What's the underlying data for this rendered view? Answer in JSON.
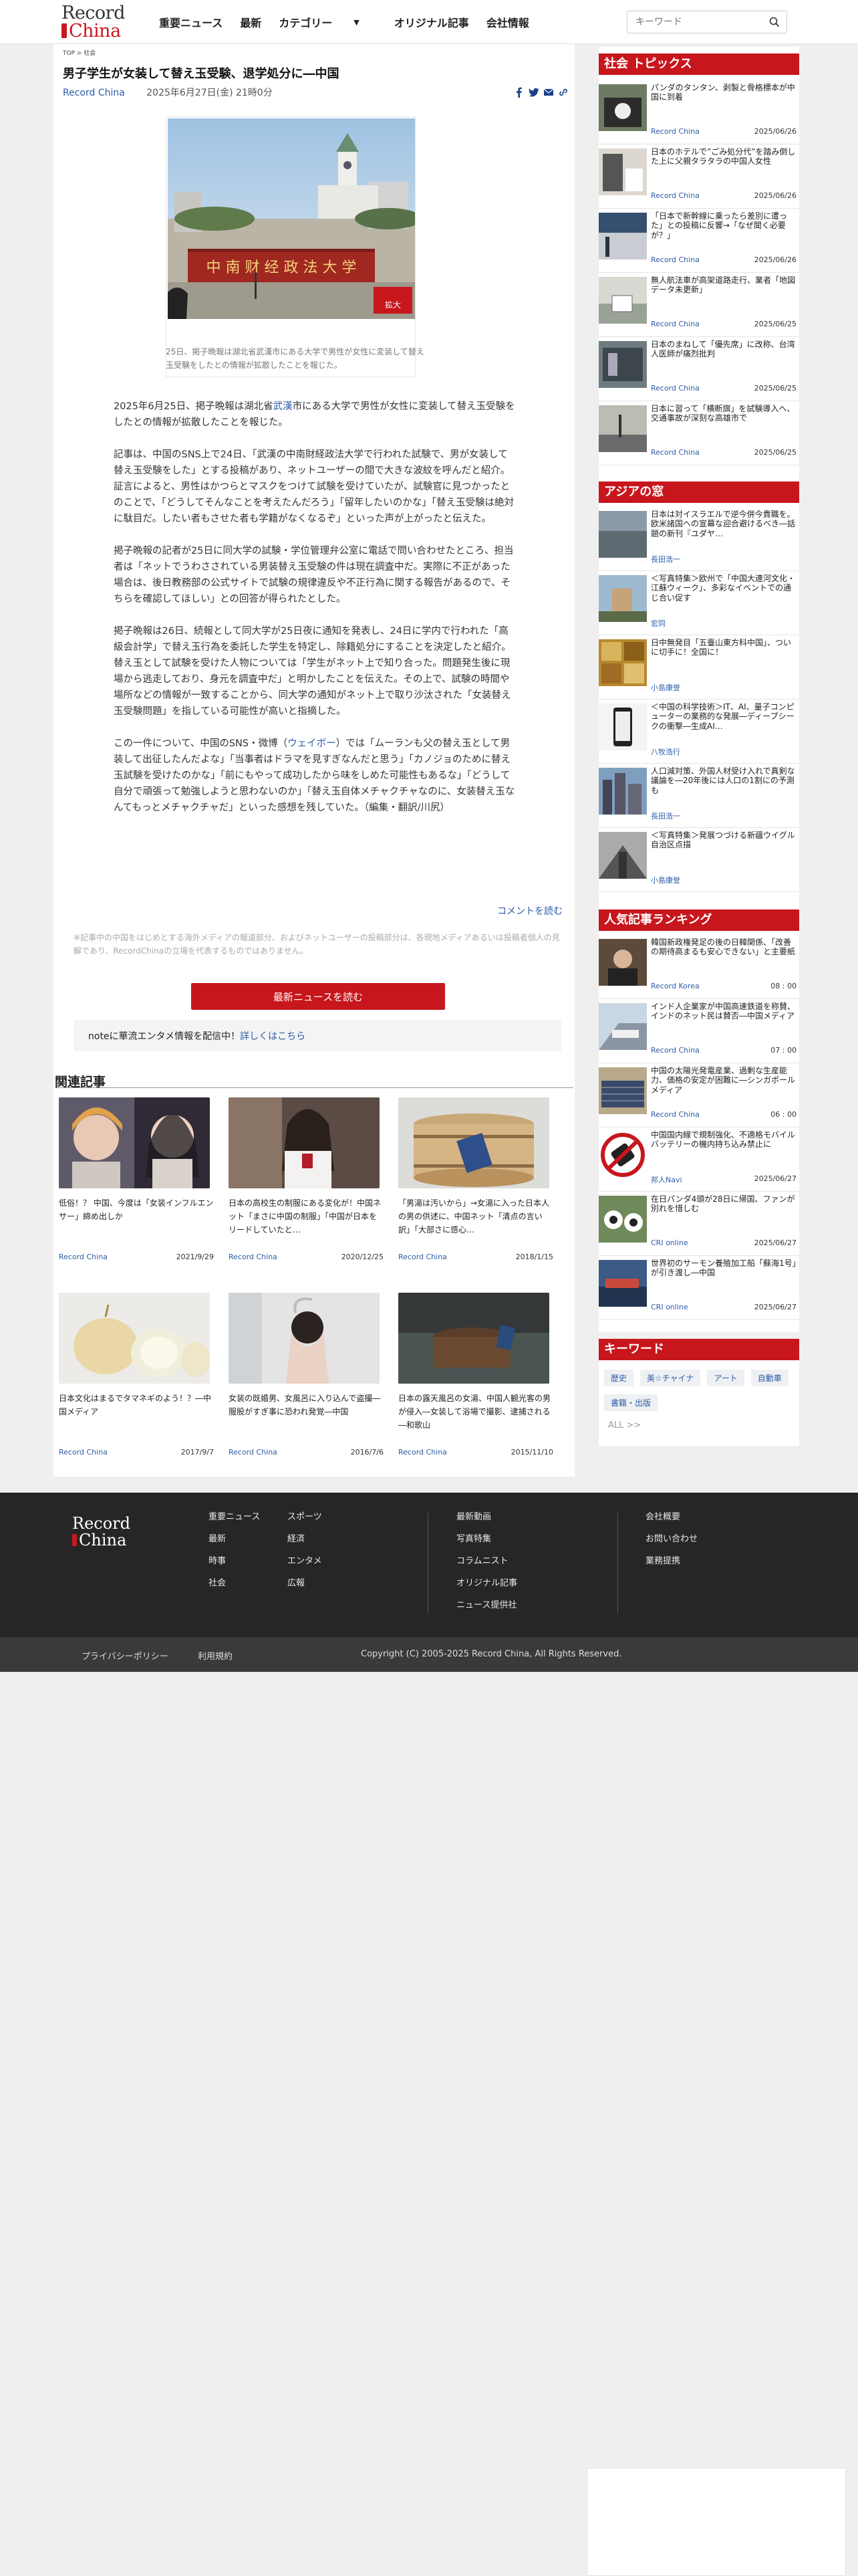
{
  "header": {
    "logo_line1": "Record",
    "logo_line2": "China",
    "nav": [
      "重要ニュース",
      "最新",
      "カテゴリー",
      "オリジナル記事",
      "会社情報"
    ],
    "category_chevron": "▼",
    "search_placeholder": "キーワード"
  },
  "article": {
    "breadcrumb": "TOP > 社会",
    "title": "男子学生が女装して替え玉受験、退学処分に―中国",
    "source": "Record China",
    "date": "2025年6月27日(金) 21時0分",
    "photo_sign": "中 南 财 经 政 法 大 学",
    "zoom": "拡大",
    "caption": "25日、掲子晩報は湖北省武漢市にある大学で男性が女性に変装して替え玉受験をしたとの情報が拡散したことを報じた。",
    "paragraphs": [
      {
        "pre": "2025年6月25日、掲子晩報は湖北省",
        "link": "武漢",
        "post": "市にある大学で男性が女性に変装して替え玉受験をしたとの情報が拡散したことを報じた。"
      },
      {
        "pre": "記事は、中国のSNS上で24日、「武漢の中南財経政法大学で行われた試験で、男が女装して替え玉受験をした」とする投稿があり、ネットユーザーの間で大きな波紋を呼んだと紹介。証言によると、男性はかつらとマスクをつけて試験を受けていたが、試験官に見つかったとのことで、「どうしてそんなことを考えたんだろう」「留年したいのかな」「替え玉受験は絶対に駄目だ。したい者もさせた者も学籍がなくなるぞ」といった声が上がったと伝えた。",
        "link": "",
        "post": ""
      },
      {
        "pre": "掲子晩報の記者が25日に同大学の試験・学位管理弁公室に電話で問い合わせたところ、担当者は「ネットでうわさされている男装替え玉受験の件は現在調査中だ。実際に不正があった場合は、後日教務部の公式サイトで試験の規律違反や不正行為に関する報告があるので、そちらを確認してほしい」との回答が得られたとした。",
        "link": "",
        "post": ""
      },
      {
        "pre": "掲子晩報は26日、続報として同大学が25日夜に通知を発表し、24日に学内で行われた「高級会計学」で替え玉行為を委託した学生を特定し、除籍処分にすることを決定したと紹介。替え玉として試験を受けた人物については「学生がネット上で知り合った。問題発生後に現場から逃走しており、身元を調査中だ」と明かしたことを伝えた。その上で、試験の時間や場所などの情報が一致することから、同大学の通知がネット上で取り沙汰された「女装替え玉受験問題」を指している可能性が高いと指摘した。",
        "link": "",
        "post": ""
      },
      {
        "pre": "この一件について、中国のSNS・微博（",
        "link": "ウェイボー",
        "post": "）では「ムーランも父の替え玉として男装して出征したんだよな」「当事者はドラマを見すぎなんだと思う」「カノジョのために替え玉試験を受けたのかな」「前にもやって成功したから味をしめた可能性もあるな」「どうして自分で頑張って勉強しようと思わないのか」「替え玉自体メチャクチャなのに、女装替え玉なんてもっとメチャクチャだ」といった感想を残していた。（編集・翻訳/川尻）"
      }
    ],
    "comments_link": "コメントを読む",
    "disclaimer": "※記事中の中国をはじめとする海外メディアの報道部分、およびネットユーザーの投稿部分は、各現地メディアあるいは投稿者個人の見解であり、RecordChinaの立場を代表するものではありません。",
    "read_news_button": "最新ニュースを読む",
    "note_text": "noteに華流エンタメ情報を配信中！",
    "note_link": "詳しくはこちら"
  },
  "related": {
    "heading": "関連記事",
    "items": [
      {
        "title": "低俗！？ 中国、今度は「女装インフルエンサー」締め出しか",
        "source": "Record China",
        "date": "2021/9/29"
      },
      {
        "title": "日本の高校生の制服にある変化が！中国ネット「まさに中国の制服」「中国が日本をリードしていたと…",
        "source": "Record China",
        "date": "2020/12/25"
      },
      {
        "title": "「男湯は汚いから」→女湯に入った日本人の男の供述に、中国ネット「清点の言い訳」「大部さに感心…",
        "source": "Record China",
        "date": "2018/1/15"
      },
      {
        "title": "日本文化はまるでタマネギのよう！？―中国メディア",
        "source": "Record China",
        "date": "2017/9/7"
      },
      {
        "title": "女装の既婚男、女風呂に入り込んで盗撮―服股がすぎ事に恐われ発覚―中国",
        "source": "Record China",
        "date": "2016/7/6"
      },
      {
        "title": "日本の露天風呂の女湯、中国人観光客の男が侵入―女装して浴場で撮影、逮捕される―和歌山",
        "source": "Record China",
        "date": "2015/11/10"
      }
    ]
  },
  "sidebar": {
    "social_heading": "社会 トピックス",
    "social": [
      {
        "title": "パンダのタンタン、剥製と骨格標本が中国に到着",
        "source": "Record China",
        "date": "2025/06/26"
      },
      {
        "title": "日本のホテルで”ごみ処分代”を踏み倒した上に父親タラタラの中国人女性",
        "source": "Record China",
        "date": "2025/06/26"
      },
      {
        "title": "「日本で新幹線に乗ったら差別に遭った」との投稿に反響→「なぜ聞く必要が？」",
        "source": "Record China",
        "date": "2025/06/26"
      },
      {
        "title": "無人航法車が高架道路走行、業者「地図データ未更新」",
        "source": "Record China",
        "date": "2025/06/25"
      },
      {
        "title": "日本のまねして「優先席」に改称、台湾人医師が痛烈批判",
        "source": "Record China",
        "date": "2025/06/25"
      },
      {
        "title": "日本に習って「横断旗」を試験導入へ、交通事故が深刻な高雄市で",
        "source": "Record China",
        "date": "2025/06/25"
      }
    ],
    "asia_heading": "アジアの窓",
    "asia": [
      {
        "title": "日本は対イスラエルで逆今併今貴職を。欧米諸国への宣幕な迎合避けるべき―話題の新刊『ユダヤ…",
        "source": "長田浩一",
        "date": ""
      },
      {
        "title": "＜写真特集＞欧州で「中国大連河文化・江蘇ウィーク」、多彩なイベントでの通じ合い促す",
        "source": "宏同",
        "date": ""
      },
      {
        "title": "日中無発目「五臺山東方科中国」、ついに切手に！全国に！",
        "source": "小島康誉",
        "date": ""
      },
      {
        "title": "＜中国の科学技術＞IT、AI、量子コンピューターの業務的な発展―ディープシークの衝撃―生成AI…",
        "source": "八牧浩行",
        "date": ""
      },
      {
        "title": "人口減対策、外国人材受け入れで真剣な議論を―20年後には人口の1割にの予測も",
        "source": "長田浩一",
        "date": ""
      },
      {
        "title": "＜写真特集＞発展つづける新疆ウイグル自治区点描",
        "source": "小島康誉",
        "date": ""
      }
    ],
    "ranking_heading": "人気記事ランキング",
    "ranking": [
      {
        "title": "韓国新政権発足の後の日韓関係、「改善の期待高まるも安心できない」と主要紙",
        "source": "Record Korea",
        "date": "08 : 00"
      },
      {
        "title": "インド人企業家が中国高速鉄道を称賛、インドのネット民は賛否―中国メディア",
        "source": "Record China",
        "date": "07 : 00"
      },
      {
        "title": "中国の太陽光発電産業、過剰な生産能力、価格の安定が困難に―シンガポールメディア",
        "source": "Record China",
        "date": "06 : 00"
      },
      {
        "title": "中国国内線で規制強化、不適格モバイルバッテリーの機内持ち込み禁止に",
        "source": "邦人Navi",
        "date": "2025/06/27"
      },
      {
        "title": "在日パンダ4頭が28日に帰国、ファンが別れを惜しむ",
        "source": "CRI online",
        "date": "2025/06/27"
      },
      {
        "title": "世界初のサーモン養殖加工船「蘇海1号」が引き渡し―中国",
        "source": "CRI online",
        "date": "2025/06/27"
      }
    ],
    "keyword_heading": "キーワード",
    "tags": [
      "歴史",
      "美☆チャイナ",
      "アート",
      "自動車",
      "書籍・出版"
    ],
    "all_label": "ALL  >>"
  },
  "footer": {
    "logo_line1": "Record",
    "logo_line2": "China",
    "col1": [
      "重要ニュース",
      "最新",
      "時事",
      "社会"
    ],
    "col2": [
      "スポーツ",
      "経済",
      "エンタメ",
      "広報"
    ],
    "col3": [
      "最新動画",
      "写真特集",
      "コラムニスト",
      "オリジナル記事",
      "ニュース提供社"
    ],
    "col4": [
      "会社概要",
      "お問い合わせ",
      "業務提携"
    ],
    "privacy": "プライバシーポリシー",
    "terms": "利用規約",
    "copyright": "Copyright (C) 2005-2025 Record China, All Rights Reserved."
  },
  "colors": {
    "brand_red": "#c8161d",
    "link_blue": "#2d5ca8",
    "footer_bg": "#262626"
  }
}
